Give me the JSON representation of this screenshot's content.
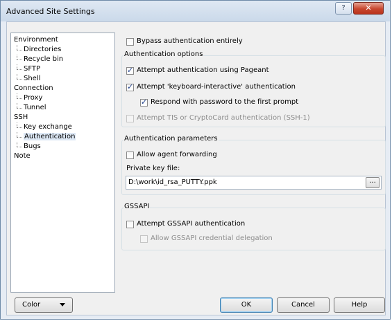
{
  "window": {
    "title": "Advanced Site Settings",
    "help_glyph": "?",
    "close_glyph": "✕"
  },
  "tree": {
    "items": [
      {
        "label": "Environment",
        "level": 0
      },
      {
        "label": "Directories",
        "level": 1
      },
      {
        "label": "Recycle bin",
        "level": 1
      },
      {
        "label": "SFTP",
        "level": 1
      },
      {
        "label": "Shell",
        "level": 1
      },
      {
        "label": "Connection",
        "level": 0
      },
      {
        "label": "Proxy",
        "level": 1
      },
      {
        "label": "Tunnel",
        "level": 1
      },
      {
        "label": "SSH",
        "level": 0
      },
      {
        "label": "Key exchange",
        "level": 1
      },
      {
        "label": "Authentication",
        "level": 1,
        "selected": true
      },
      {
        "label": "Bugs",
        "level": 1
      },
      {
        "label": "Note",
        "level": 0
      }
    ]
  },
  "main": {
    "bypass_auth": {
      "label": "Bypass authentication entirely",
      "checked": false
    },
    "auth_options": {
      "title": "Authentication options",
      "pageant": {
        "label": "Attempt authentication using Pageant",
        "checked": true
      },
      "keyboard_interactive": {
        "label": "Attempt 'keyboard-interactive' authentication",
        "checked": true
      },
      "respond_password": {
        "label": "Respond with password to the first prompt",
        "checked": true
      },
      "tis": {
        "label": "Attempt TIS or CryptoCard authentication (SSH-1)",
        "checked": false,
        "disabled": true
      }
    },
    "auth_params": {
      "title": "Authentication parameters",
      "agent_forwarding": {
        "label": "Allow agent forwarding",
        "checked": false
      },
      "private_key_label": "Private key file:",
      "private_key_value": "D:\\work\\id_rsa_PUTTY.ppk",
      "browse_label": "..."
    },
    "gssapi": {
      "title": "GSSAPI",
      "attempt": {
        "label": "Attempt GSSAPI authentication",
        "checked": false
      },
      "delegation": {
        "label": "Allow GSSAPI credential delegation",
        "checked": false,
        "disabled": true
      }
    }
  },
  "buttons": {
    "color": "Color",
    "ok": "OK",
    "cancel": "Cancel",
    "help": "Help"
  }
}
